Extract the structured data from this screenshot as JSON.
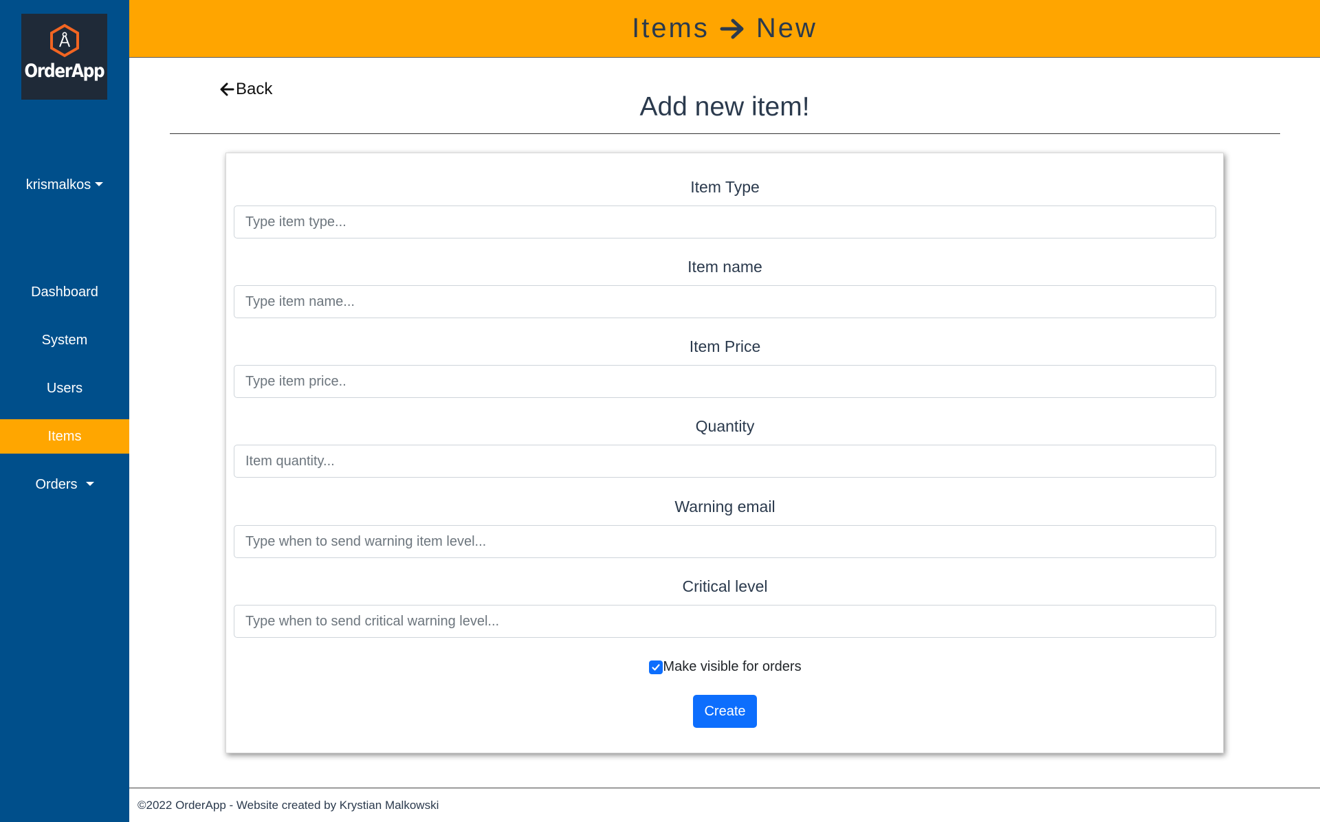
{
  "brand": {
    "name": "OrderApp",
    "icon": "compass-hexagon-icon",
    "accent": "#ffa500"
  },
  "header": {
    "section": "Items",
    "arrow_icon": "arrow-right-icon",
    "page": "New"
  },
  "sidebar": {
    "user": "krismalkos",
    "items": [
      {
        "label": "Dashboard",
        "active": false
      },
      {
        "label": "System",
        "active": false
      },
      {
        "label": "Users",
        "active": false
      },
      {
        "label": "Items",
        "active": true
      },
      {
        "label": "Orders",
        "active": false,
        "has_dropdown": true
      }
    ]
  },
  "back": {
    "label": "Back",
    "icon": "arrow-left-icon"
  },
  "page_title": "Add new item!",
  "form": {
    "fields": [
      {
        "label": "Item Type",
        "placeholder": "Type item type..."
      },
      {
        "label": "Item name",
        "placeholder": "Type item name..."
      },
      {
        "label": "Item Price",
        "placeholder": "Type item price.."
      },
      {
        "label": "Quantity",
        "placeholder": "Item quantity..."
      },
      {
        "label": "Warning email",
        "placeholder": "Type when to send warning item level..."
      },
      {
        "label": "Critical level",
        "placeholder": "Type when to send critical warning level..."
      }
    ],
    "visible_checkbox": {
      "label": "Make visible for orders",
      "checked": true
    },
    "submit_label": "Create"
  },
  "footer": {
    "text": "©2022 OrderApp - Website created by Krystian Malkowski"
  },
  "colors": {
    "sidebar": "#004f8b",
    "header": "#ffa500",
    "primary": "#0d6efd"
  }
}
